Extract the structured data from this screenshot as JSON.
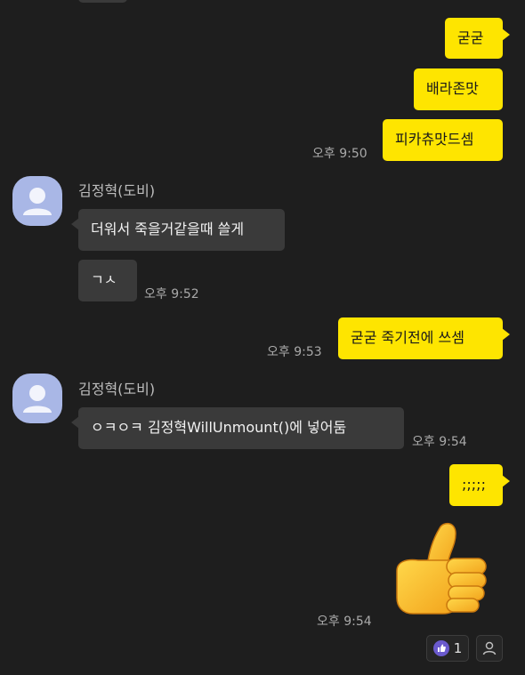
{
  "chat": {
    "messages_out_1": [
      "굳굳",
      "배라존맛",
      "피카츄맛드셈"
    ],
    "time_out_1": "오후 9:50",
    "sender_name": "김정혁(도비)",
    "group_in_1": {
      "messages": [
        "더워서 죽을거같을때 쓸게",
        "ㄱㅅ"
      ],
      "time": "오후 9:52"
    },
    "out_2": {
      "text": "굳굳 죽기전에 쓰셈",
      "time": "오후 9:53"
    },
    "group_in_2": {
      "messages": [
        "ㅇㅋㅇㅋ 김정혁WillUnmount()에 넣어둠"
      ],
      "time": "오후 9:54"
    },
    "out_3": {
      "text": ";;;;;",
      "time": "오후 9:54"
    },
    "reactions": {
      "like_count": "1"
    }
  },
  "colors": {
    "background": "#1e1e1e",
    "outgoing_bubble": "#fee500",
    "incoming_bubble": "#3a3a3a",
    "avatar": "#a9b7e6",
    "like_badge": "#6a5acd"
  },
  "icons": [
    "user-silhouette-icon",
    "thumbs-up-emoji",
    "like-icon",
    "person-icon"
  ]
}
